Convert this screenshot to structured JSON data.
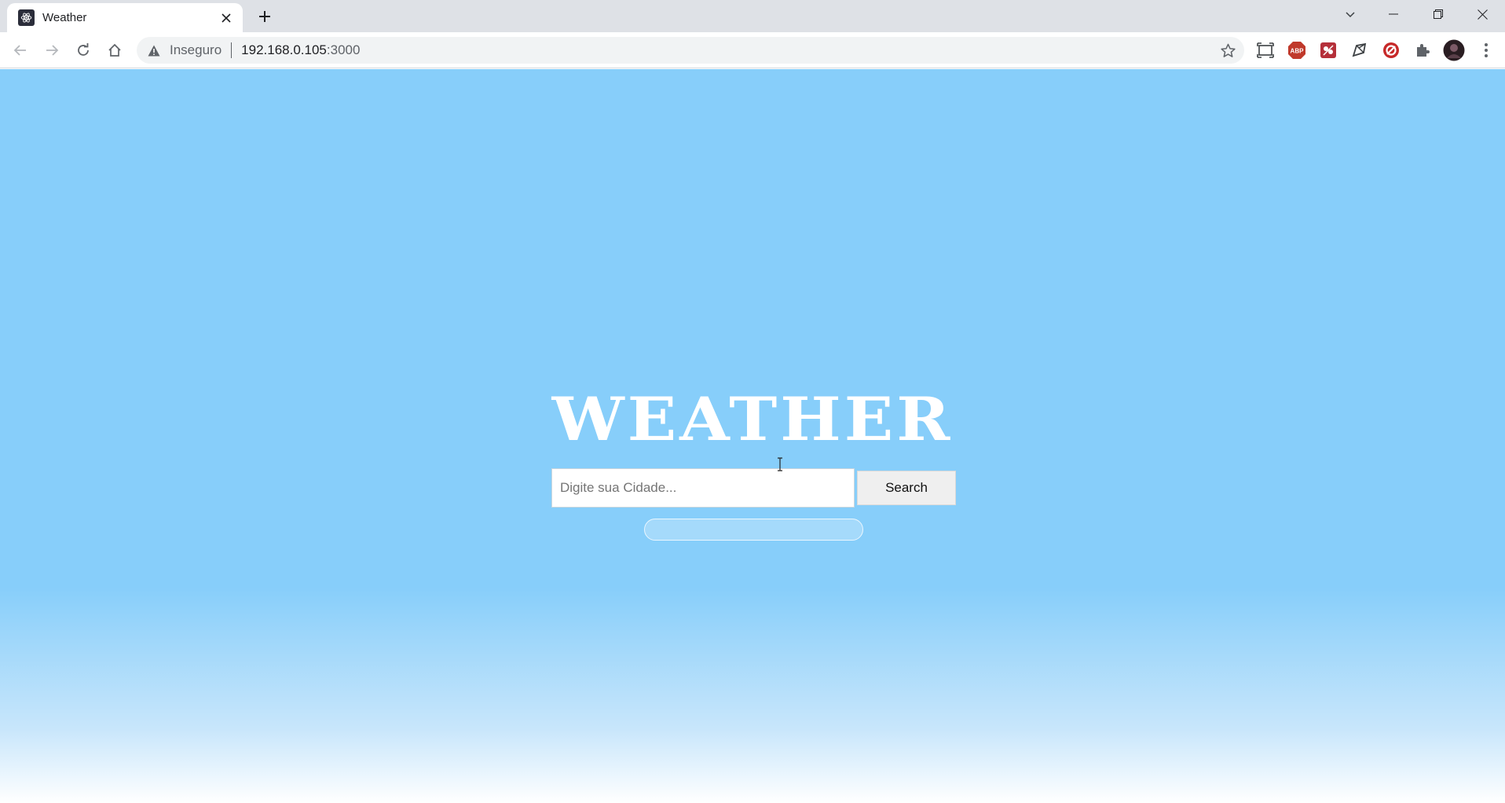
{
  "browser": {
    "tab": {
      "title": "Weather",
      "favicon": "react-icon"
    },
    "new_tab_icon": "plus-icon",
    "window_controls": [
      "minimize-icon",
      "restore-icon",
      "close-icon"
    ],
    "address_bar": {
      "security_label": "Inseguro",
      "url_host": "192.168.0.105",
      "url_port": ":3000"
    },
    "extensions": [
      "screen-capture-icon",
      "adblock-plus-icon",
      "extension-red-icon",
      "extension-pen-icon",
      "extension-red-circle-icon",
      "puzzle-icon",
      "profile-avatar"
    ]
  },
  "page": {
    "title": "WEATHER",
    "search": {
      "placeholder": "Digite sua Cidade...",
      "value": "",
      "button_label": "Search"
    },
    "colors": {
      "background_top": "#87cefa",
      "background_bottom": "#ffffff",
      "title": "#ffffff"
    }
  }
}
